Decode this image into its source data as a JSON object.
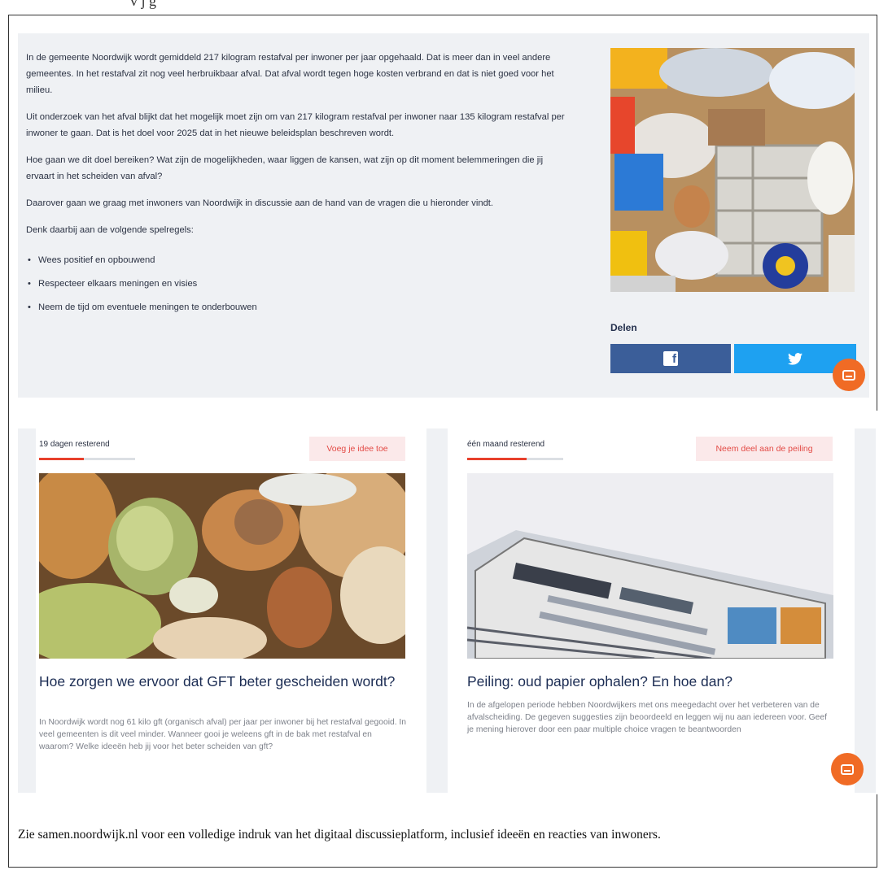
{
  "heading_fragment": "v        j         g",
  "intro": {
    "paragraphs": [
      "In de gemeente Noordwijk wordt gemiddeld 217 kilogram restafval per inwoner per jaar opgehaald. Dat is meer dan in veel andere gemeentes. In het restafval zit nog veel herbruikbaar afval. Dat afval wordt tegen hoge kosten verbrand en dat is niet goed voor het milieu.",
      "Uit onderzoek van het afval blijkt dat het mogelijk moet zijn om van 217 kilogram restafval per inwoner naar 135 kilogram restafval per inwoner te gaan. Dat is het doel voor 2025 dat in het nieuwe beleidsplan beschreven wordt.",
      "Hoe gaan we dit doel bereiken? Wat zijn de mogelijkheden, waar liggen de kansen, wat zijn op dit moment belemmeringen die jij ervaart in het scheiden van afval?",
      "Daarover gaan we graag met inwoners van Noordwijk in discussie aan de hand van de vragen die u hieronder vindt.",
      "Denk daarbij aan de volgende spelregels:"
    ],
    "rules": [
      "Wees positief en opbouwend",
      "Respecteer elkaars meningen en visies",
      "Neem de tijd om eventuele meningen te onderbouwen"
    ],
    "share_label": "Delen",
    "facebook_glyph": "f",
    "colors": {
      "facebook": "#3b5e99",
      "twitter": "#1ea1f1",
      "chat": "#f06b25",
      "accent": "#e8402c"
    }
  },
  "cards": [
    {
      "days_left": "19 dagen resterend",
      "progress": 0.47,
      "cta": "Voeg je idee toe",
      "title": "Hoe zorgen we ervoor dat GFT beter gescheiden wordt?",
      "description": "In Noordwijk wordt nog 61 kilo gft (organisch afval) per jaar per inwoner bij het restafval gegooid. In veel gemeenten is dit veel minder. Wanneer gooi je weleens gft in de bak met restafval en waarom? Welke ideeën heb jij voor het beter scheiden van gft?"
    },
    {
      "days_left": "één maand resterend",
      "progress": 0.62,
      "cta": "Neem deel aan de peiling",
      "title": "Peiling: oud papier ophalen? En hoe dan?",
      "description": "In de afgelopen periode hebben Noordwijkers met ons meegedacht over het verbeteren van de afvalscheiding. De gegeven suggesties zijn beoordeeld en leggen wij nu aan iedereen voor. Geef je mening hierover door een paar multiple choice vragen te beantwoorden"
    }
  ],
  "footer": "Zie samen.noordwijk.nl voor een volledige indruk van het digitaal discussieplatform, inclusief ideeën en reacties van inwoners."
}
